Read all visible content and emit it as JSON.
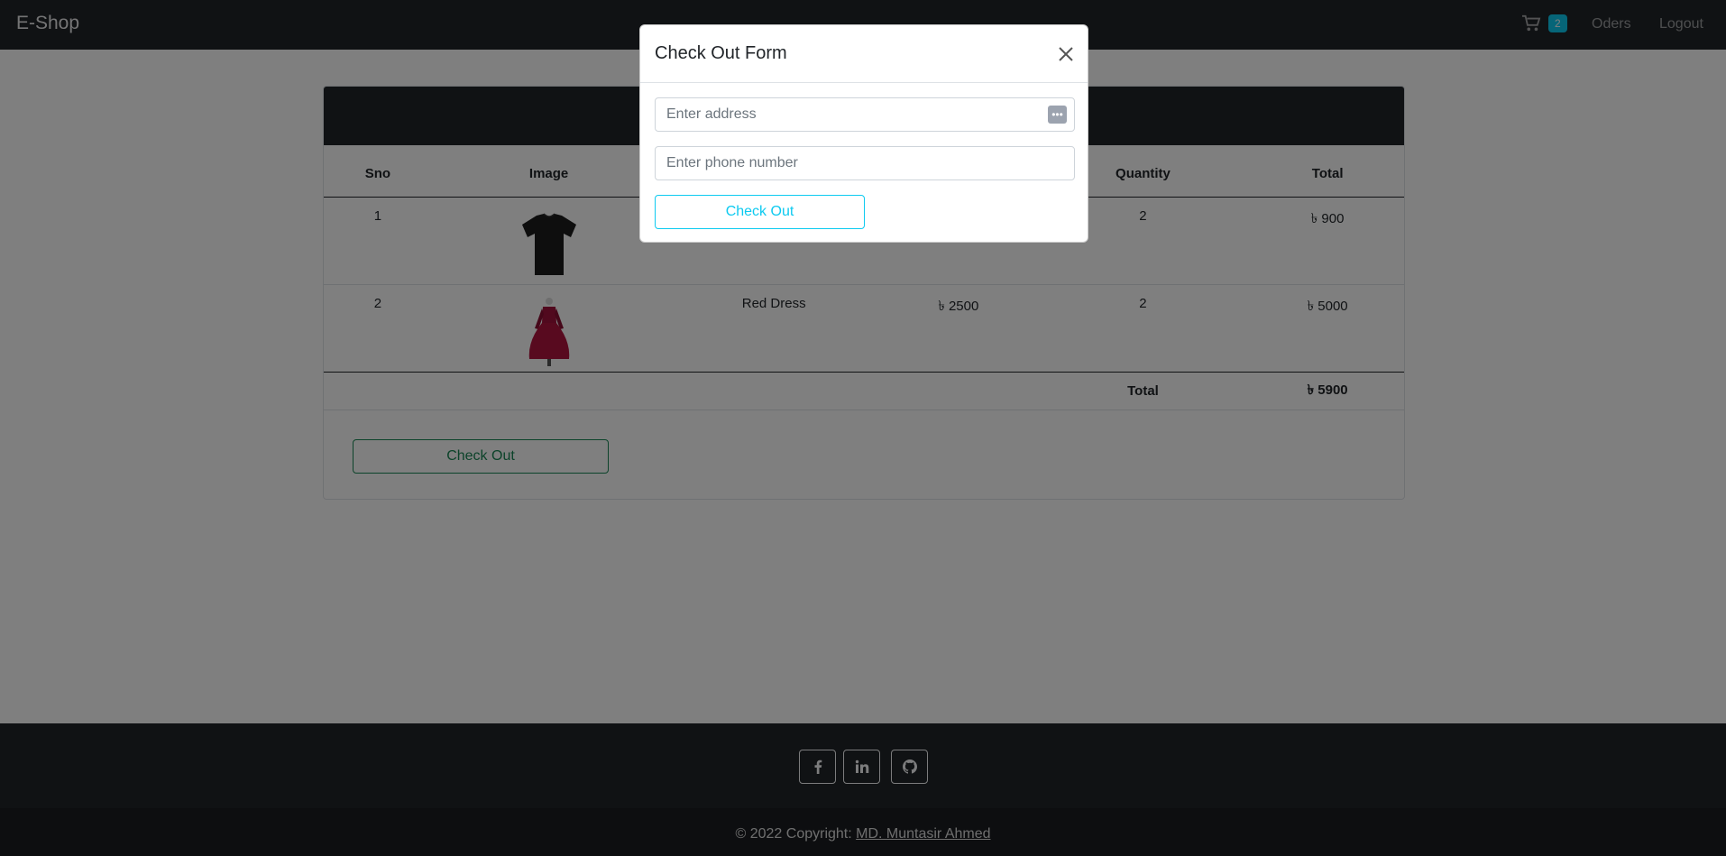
{
  "navbar": {
    "brand": "E-Shop",
    "cart_count": "2",
    "orders_label": "Oders",
    "logout_label": "Logout"
  },
  "cart_table": {
    "headers": {
      "sno": "Sno",
      "image": "Image",
      "name": "",
      "price": "",
      "quantity": "Quantity",
      "total": "Total"
    },
    "rows": [
      {
        "sno": "1",
        "image_icon": "black-tshirt",
        "name": "",
        "price": "",
        "quantity": "2",
        "total": "৳ 900"
      },
      {
        "sno": "2",
        "image_icon": "red-dress",
        "name": "Red Dress",
        "price": "৳ 2500",
        "quantity": "2",
        "total": "৳ 5000"
      }
    ],
    "footer_label": "Total",
    "footer_total": "৳ 5900",
    "checkout_label": "Check Out"
  },
  "modal": {
    "title": "Check Out Form",
    "address_placeholder": "Enter address",
    "phone_placeholder": "Enter phone number",
    "checkout_label": "Check Out"
  },
  "footer": {
    "social": [
      "facebook-icon",
      "linkedin-icon",
      "github-icon"
    ],
    "copyright": "© 2022 Copyright: ",
    "author": "MD. Muntasir Ahmed"
  },
  "colors": {
    "dark": "#212529",
    "success": "#198754",
    "info": "#0dcaf0",
    "dress_red": "#a3123c"
  }
}
